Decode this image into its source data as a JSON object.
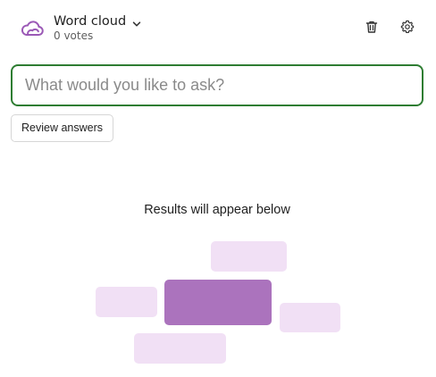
{
  "header": {
    "app_icon": "cloud-icon",
    "title": "Word cloud",
    "title_dropdown_icon": "chevron-down-icon",
    "subtitle": "0 votes",
    "actions": [
      {
        "icon": "trash-icon"
      },
      {
        "icon": "gear-icon"
      }
    ]
  },
  "question_input": {
    "value": "",
    "placeholder": "What would you like to ask?"
  },
  "review_button": {
    "label": "Review answers"
  },
  "results": {
    "empty_message": "Results will appear below"
  },
  "colors": {
    "accent_purple": "#9b59b6",
    "input_border_green": "#2e7d32",
    "placeholder_block_light": "#f1e0f5",
    "placeholder_block_dark": "#ab73bd"
  },
  "placeholder_blocks": [
    {
      "name": "top",
      "tone": "light"
    },
    {
      "name": "left",
      "tone": "light"
    },
    {
      "name": "center",
      "tone": "dark"
    },
    {
      "name": "right",
      "tone": "light"
    },
    {
      "name": "bottom",
      "tone": "light"
    }
  ]
}
